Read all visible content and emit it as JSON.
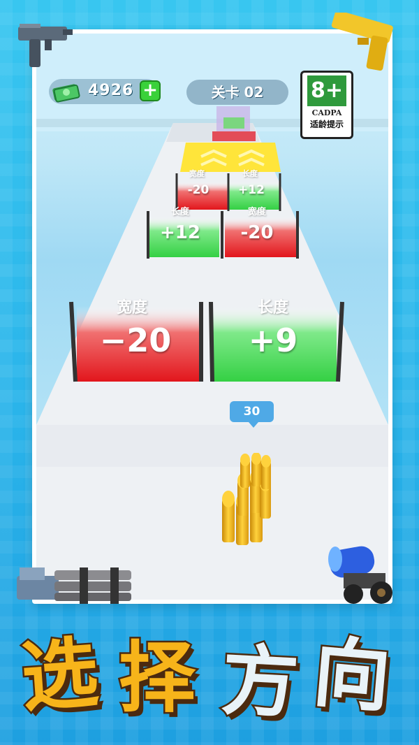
{
  "hud": {
    "money": "4926",
    "add_label": "+",
    "level": "关卡 02"
  },
  "rating": {
    "age": "8+",
    "org": "CADPA",
    "tip": "适龄提示"
  },
  "gates": [
    {
      "label": "宽度",
      "value": "-20",
      "color": "red"
    },
    {
      "label": "长度",
      "value": "+12",
      "color": "green"
    },
    {
      "label": "长度",
      "value": "+12",
      "color": "green"
    },
    {
      "label": "宽度",
      "value": "-20",
      "color": "red"
    },
    {
      "label": "宽度",
      "value": "−20",
      "color": "red"
    },
    {
      "label": "长度",
      "value": "+9",
      "color": "green"
    }
  ],
  "ammo_count": "30",
  "title": [
    "选",
    "择",
    "方",
    "向"
  ],
  "colors": {
    "gate_red": "#e8262a",
    "gate_green": "#3ad74a",
    "bullet_gold": "#f5b81c",
    "title_fill": "#f7b41a",
    "title_outline": "#4b2a0f"
  },
  "icons": [
    "uzi-icon",
    "pistol-icon",
    "minigun-icon",
    "cannon-icon",
    "cash-icon"
  ]
}
